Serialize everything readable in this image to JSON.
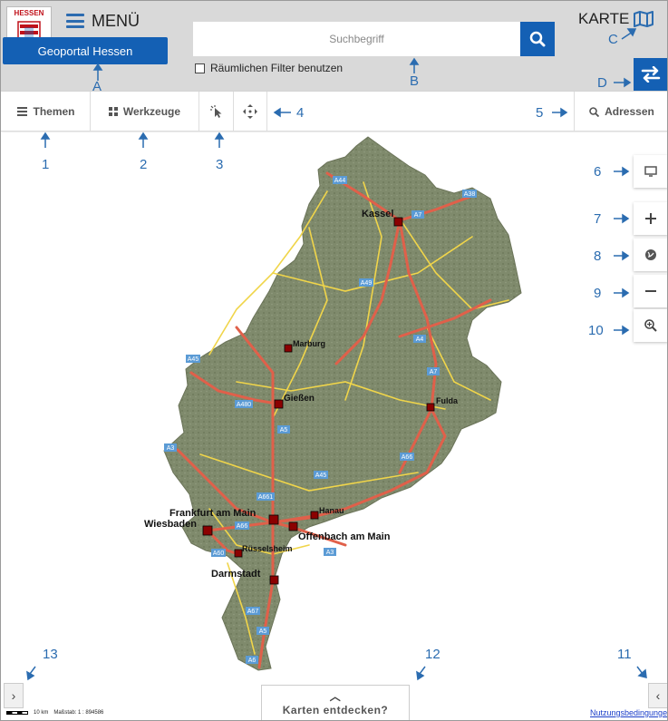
{
  "header": {
    "logo_text": "HESSEN",
    "menu_label": "MENÜ",
    "portal_label": "Geoportal Hessen",
    "search_placeholder": "Suchbegriff",
    "filter_label": "Räumlichen Filter benutzen",
    "karte_label": "KARTE"
  },
  "toolbar": {
    "themen": "Themen",
    "werkzeuge": "Werkzeuge",
    "adressen": "Adressen"
  },
  "annotations": {
    "A": "A",
    "B": "B",
    "C": "C",
    "D": "D",
    "n1": "1",
    "n2": "2",
    "n3": "3",
    "n4": "4",
    "n5": "5",
    "n6": "6",
    "n7": "7",
    "n8": "8",
    "n9": "9",
    "n10": "10",
    "n11": "11",
    "n12": "12",
    "n13": "13"
  },
  "map": {
    "cities": [
      "Kassel",
      "Marburg",
      "Gießen",
      "Fulda",
      "Hanau",
      "Frankfurt am Main",
      "Wiesbaden",
      "Offenbach am Main",
      "Rüsselsheim",
      "Darmstadt"
    ],
    "roads": [
      "A44",
      "A7",
      "A38",
      "A49",
      "A4",
      "A5",
      "A45",
      "A480",
      "A3",
      "A66",
      "A661",
      "A60",
      "A67",
      "A6"
    ]
  },
  "footer": {
    "discover_label": "Karten entdecken?",
    "scale_distance": "10 km",
    "scale_ratio": "Maßstab: 1 : 894586",
    "terms_label": "Nutzungsbedingungen"
  },
  "colors": {
    "primary": "#1460b4",
    "annotation": "#2b6cb0",
    "header_bg": "#d9d9d9",
    "map_terrain": "#7f8a6c",
    "autobahn": "#e0604a",
    "road": "#f0d54a"
  }
}
